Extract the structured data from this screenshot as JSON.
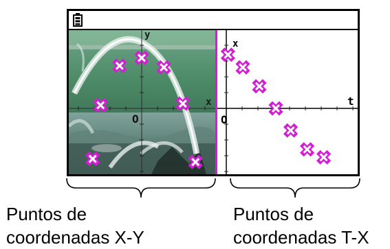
{
  "screen": {
    "status_icon": "battery-icon",
    "photo_panel": {
      "axis_y_label": "y",
      "axis_x_label": "x",
      "origin_label": "O",
      "marker_icon": "cross-marker-icon",
      "marker_color": "#d21fd2",
      "points": [
        {
          "x": -3.1,
          "y": -3.2
        },
        {
          "x": -2.6,
          "y": 0.2
        },
        {
          "x": -1.4,
          "y": 2.7
        },
        {
          "x": 0.0,
          "y": 3.2
        },
        {
          "x": 1.4,
          "y": 2.6
        },
        {
          "x": 2.6,
          "y": 0.3
        },
        {
          "x": 3.4,
          "y": -3.4
        }
      ]
    },
    "tx_panel": {
      "axis_x_label": "x",
      "axis_t_label": "t",
      "origin_label": "O",
      "marker_icon": "cross-marker-icon",
      "marker_color": "#d21fd2",
      "points": [
        {
          "t": 0.1,
          "x": 3.4
        },
        {
          "t": 1.0,
          "x": 2.6
        },
        {
          "t": 2.0,
          "x": 1.4
        },
        {
          "t": 3.0,
          "x": 0.0
        },
        {
          "t": 3.9,
          "x": -1.4
        },
        {
          "t": 4.9,
          "x": -2.6
        },
        {
          "t": 5.9,
          "x": -3.1
        }
      ]
    }
  },
  "captions": {
    "left": {
      "line1": "Puntos de",
      "line2": "coordenadas X-Y"
    },
    "right": {
      "line1": "Puntos de",
      "line2": "coordenadas T-X"
    }
  }
}
